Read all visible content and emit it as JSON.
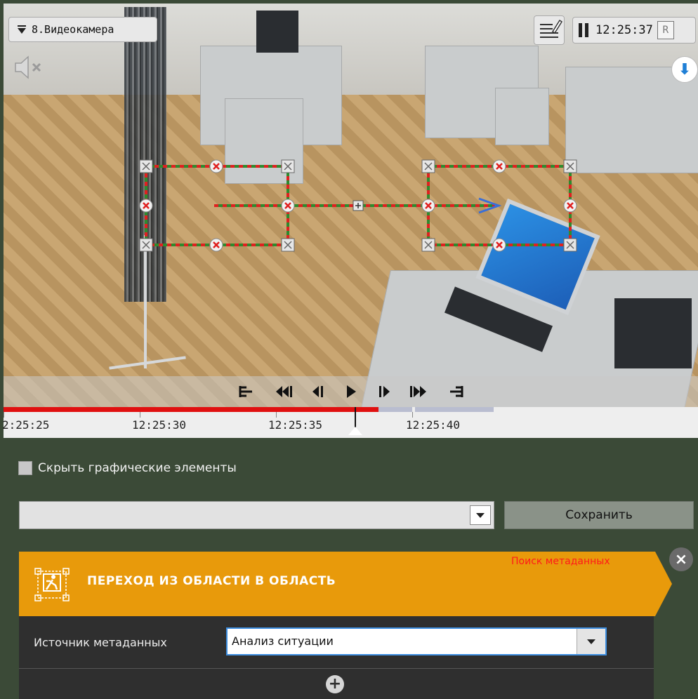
{
  "camera": {
    "label": "8.Видеокамера"
  },
  "clock": {
    "time": "12:25:37",
    "badge": "R"
  },
  "playback": {
    "controls": [
      "go-to-start",
      "fast-rewind",
      "step-back",
      "play",
      "step-forward",
      "fast-forward",
      "go-to-end"
    ]
  },
  "timeline": {
    "labels": [
      "2:25:25",
      "12:25:30",
      "12:25:35",
      "12:25:40"
    ]
  },
  "panel": {
    "hide_graphics_label": "Скрыть графические элементы",
    "preset_select_value": "",
    "save_label": "Сохранить"
  },
  "detector": {
    "title": "ПЕРЕХОД ИЗ ОБЛАСТИ В ОБЛАСТЬ",
    "search_link": "Поиск метаданных",
    "close_symbol": "×",
    "metadata_source_label": "Источник метаданных",
    "metadata_source_value": "Анализ ситуации",
    "add_symbol": "+"
  },
  "colors": {
    "accent_orange": "#e89a0b",
    "panel_bg": "#3b4a37",
    "timeline_red": "#e01010",
    "zone_line_red": "#e02020",
    "zone_line_green": "#2e8b2e",
    "link_red": "#ff1a1a"
  }
}
